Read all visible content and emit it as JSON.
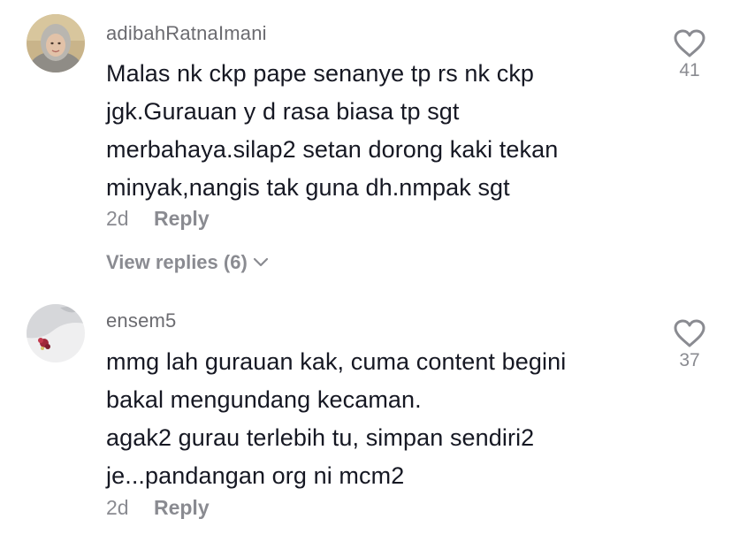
{
  "comments": [
    {
      "username": "adibahRatnaImani",
      "lines": [
        "Malas nk ckp pape senanye tp rs nk ckp",
        "jgk.Gurauan y d rasa biasa tp sgt",
        "merbahaya.silap2 setan dorong kaki tekan",
        "minyak,nangis tak guna dh.nmpak sgt"
      ],
      "time": "2d",
      "reply_label": "Reply",
      "view_replies_label": "View replies (6)",
      "likes": "41",
      "avatar_icon": "avatar-photo-woman-hijab",
      "like_icon": "heart-outline-icon"
    },
    {
      "username": "ensem5",
      "lines": [
        "mmg lah gurauan kak, cuma content begini",
        "bakal mengundang kecaman.",
        "agak2 gurau terlebih tu, simpan sendiri2",
        "je...pandangan org ni mcm2"
      ],
      "time": "2d",
      "reply_label": "Reply",
      "likes": "37",
      "avatar_icon": "avatar-photo-flower",
      "like_icon": "heart-outline-icon"
    }
  ],
  "colors": {
    "primary_text": "#161823",
    "secondary_text": "#8a8b91",
    "username_text": "#6b6b70"
  }
}
